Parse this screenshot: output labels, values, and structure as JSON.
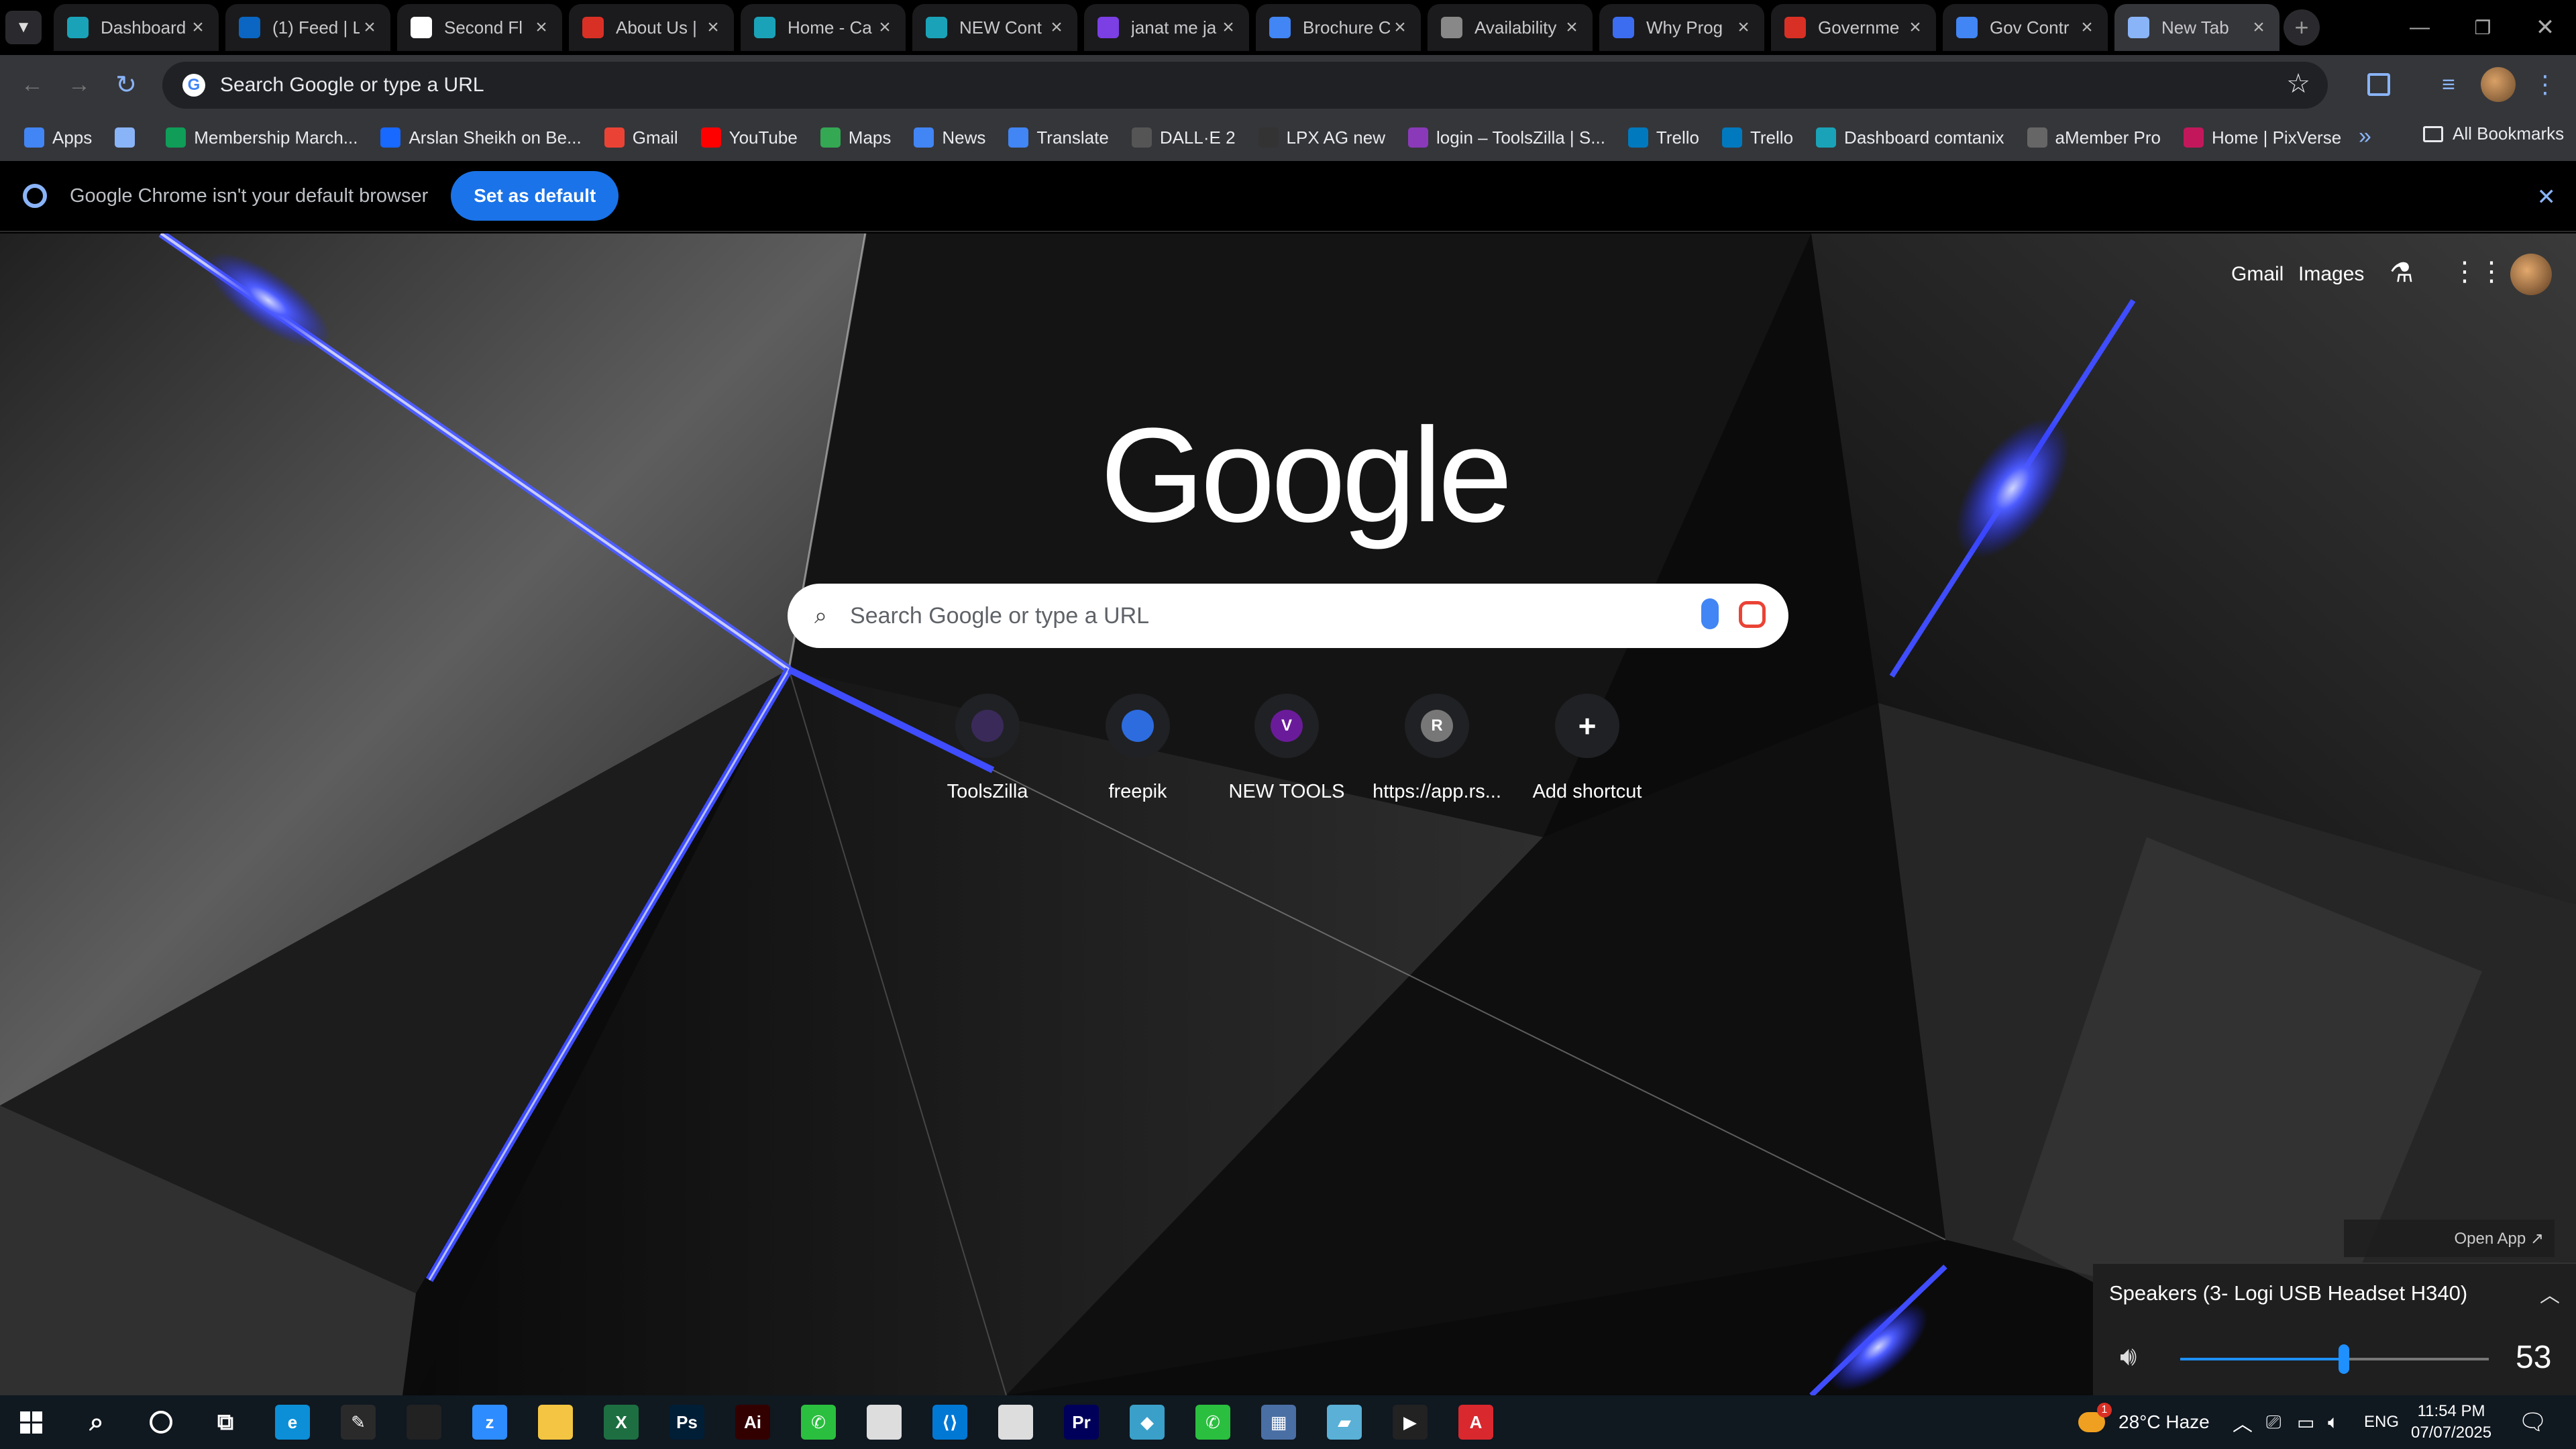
{
  "tabs": [
    {
      "label": "Dashboard",
      "icon": "dashboard-icon",
      "color": "#1aa3b8"
    },
    {
      "label": "(1) Feed | L",
      "icon": "linkedin-icon",
      "color": "#0a66c2"
    },
    {
      "label": "Second Fl",
      "icon": "sf-icon",
      "color": "#ffffff"
    },
    {
      "label": "About Us |",
      "icon": "about-icon",
      "color": "#d93025"
    },
    {
      "label": "Home - Ca",
      "icon": "home-icon",
      "color": "#1aa3b8"
    },
    {
      "label": "NEW Cont",
      "icon": "new-icon",
      "color": "#1aa3b8"
    },
    {
      "label": "janat me ja",
      "icon": "video-icon",
      "color": "#7b3fe4"
    },
    {
      "label": "Brochure C",
      "icon": "doc-icon",
      "color": "#4285f4"
    },
    {
      "label": "Availability",
      "icon": "availability-icon",
      "color": "#888888"
    },
    {
      "label": "Why Prog",
      "icon": "form-icon",
      "color": "#3c6cf0"
    },
    {
      "label": "Governme",
      "icon": "gov-icon",
      "color": "#d93025"
    },
    {
      "label": "Gov Contr",
      "icon": "doc-icon",
      "color": "#4285f4"
    },
    {
      "label": "New Tab",
      "icon": "chrome-icon",
      "color": "#8ab4f8"
    }
  ],
  "omnibox": {
    "text": "Search Google or type a URL"
  },
  "bookmarks": [
    {
      "label": "Apps",
      "color": "#4285f4"
    },
    {
      "label": "",
      "color": "#8ab4f8"
    },
    {
      "label": "Membership March...",
      "color": "#0f9d58"
    },
    {
      "label": "Arslan Sheikh on Be...",
      "color": "#1769ff"
    },
    {
      "label": "Gmail",
      "color": "#ea4335"
    },
    {
      "label": "YouTube",
      "color": "#ff0000"
    },
    {
      "label": "Maps",
      "color": "#34a853"
    },
    {
      "label": "News",
      "color": "#4285f4"
    },
    {
      "label": "Translate",
      "color": "#4285f4"
    },
    {
      "label": "DALL·E 2",
      "color": "#555555"
    },
    {
      "label": "LPX AG new",
      "color": "#333333"
    },
    {
      "label": "login – ToolsZilla | S...",
      "color": "#8a3ab9"
    },
    {
      "label": "Trello",
      "color": "#0079bf"
    },
    {
      "label": "Trello",
      "color": "#0079bf"
    },
    {
      "label": "Dashboard comtanix",
      "color": "#1aa3b8"
    },
    {
      "label": "aMember Pro",
      "color": "#666666"
    },
    {
      "label": "Home | PixVerse",
      "color": "#c2185b"
    }
  ],
  "all_bookmarks": "All Bookmarks",
  "infobar": {
    "message": "Google Chrome isn't your default browser",
    "button": "Set as default"
  },
  "ntp": {
    "gmail": "Gmail",
    "images": "Images",
    "logo": "Google",
    "search_placeholder": "Search Google or type a URL",
    "shortcuts": [
      {
        "label": "ToolsZilla",
        "letter": "",
        "color": "#3a2a5a"
      },
      {
        "label": "freepik",
        "letter": "",
        "color": "#2d6cdf"
      },
      {
        "label": "NEW TOOLS",
        "letter": "V",
        "color": "#6a1b9a"
      },
      {
        "label": "https://app.rs...",
        "letter": "R",
        "color": "#777777"
      },
      {
        "label": "Add shortcut",
        "letter": "+",
        "color": "#202124"
      }
    ]
  },
  "volume": {
    "open_app": "Open App ↗",
    "device": "Speakers (3- Logi USB Headset H340)",
    "level": 53
  },
  "taskbar": {
    "weather": "28°C  Haze",
    "weather_badge": "1",
    "language": "ENG",
    "time": "11:54 PM",
    "date": "07/07/2025",
    "apps": [
      {
        "name": "edge-icon",
        "color": "#0c8fd6",
        "glyph": "e"
      },
      {
        "name": "pen-icon",
        "color": "#2a2a2a",
        "glyph": "✎"
      },
      {
        "name": "terminal-icon",
        "color": "#222222",
        "glyph": ""
      },
      {
        "name": "zoom-icon",
        "color": "#2d8cff",
        "glyph": "z"
      },
      {
        "name": "file-explorer-icon",
        "color": "#f4c542",
        "glyph": ""
      },
      {
        "name": "excel-icon",
        "color": "#1d6f42",
        "glyph": "X"
      },
      {
        "name": "photoshop-icon",
        "color": "#001e36",
        "glyph": "Ps"
      },
      {
        "name": "illustrator-icon",
        "color": "#330000",
        "glyph": "Ai"
      },
      {
        "name": "phone-app-icon",
        "color": "#2bbf3f",
        "glyph": "✆"
      },
      {
        "name": "chrome-icon",
        "color": "#dddddd",
        "glyph": ""
      },
      {
        "name": "vscode-icon",
        "color": "#0078d4",
        "glyph": "⟨⟩"
      },
      {
        "name": "chrome-profile-icon",
        "color": "#dddddd",
        "glyph": ""
      },
      {
        "name": "premiere-icon",
        "color": "#00005b",
        "glyph": "Pr"
      },
      {
        "name": "app-icon",
        "color": "#3aa0c9",
        "glyph": "◆"
      },
      {
        "name": "phone-app-2-icon",
        "color": "#2bbf3f",
        "glyph": "✆"
      },
      {
        "name": "calculator-icon",
        "color": "#4a6fa5",
        "glyph": "▦"
      },
      {
        "name": "notes-icon",
        "color": "#5ab0d6",
        "glyph": "▰"
      },
      {
        "name": "media-player-icon",
        "color": "#222222",
        "glyph": "▶"
      },
      {
        "name": "acrobat-icon",
        "color": "#d9282e",
        "glyph": "A"
      }
    ]
  }
}
